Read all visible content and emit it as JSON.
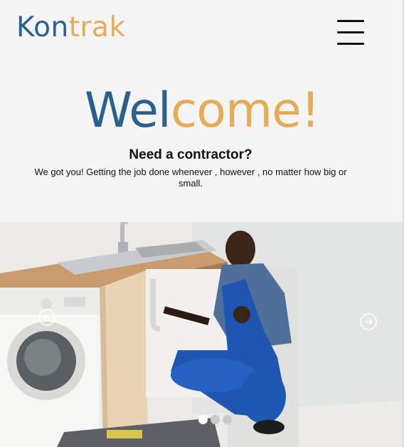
{
  "header": {
    "logo_part1": "Kon",
    "logo_part2": "trak",
    "menu_icon": "hamburger-menu-icon"
  },
  "hero": {
    "welcome_part1": "Wel",
    "welcome_part2": "come!",
    "heading": "Need a contractor?",
    "description": "We got you! Getting the job done whenever , however , no matter how big or small."
  },
  "carousel": {
    "prev_icon": "arrow-left-circle-icon",
    "next_icon": "arrow-right-circle-icon",
    "slide_count": 3,
    "active_slide": 1
  },
  "colors": {
    "brand_blue": "#2b5f8e",
    "brand_gold": "#e5ac57"
  }
}
